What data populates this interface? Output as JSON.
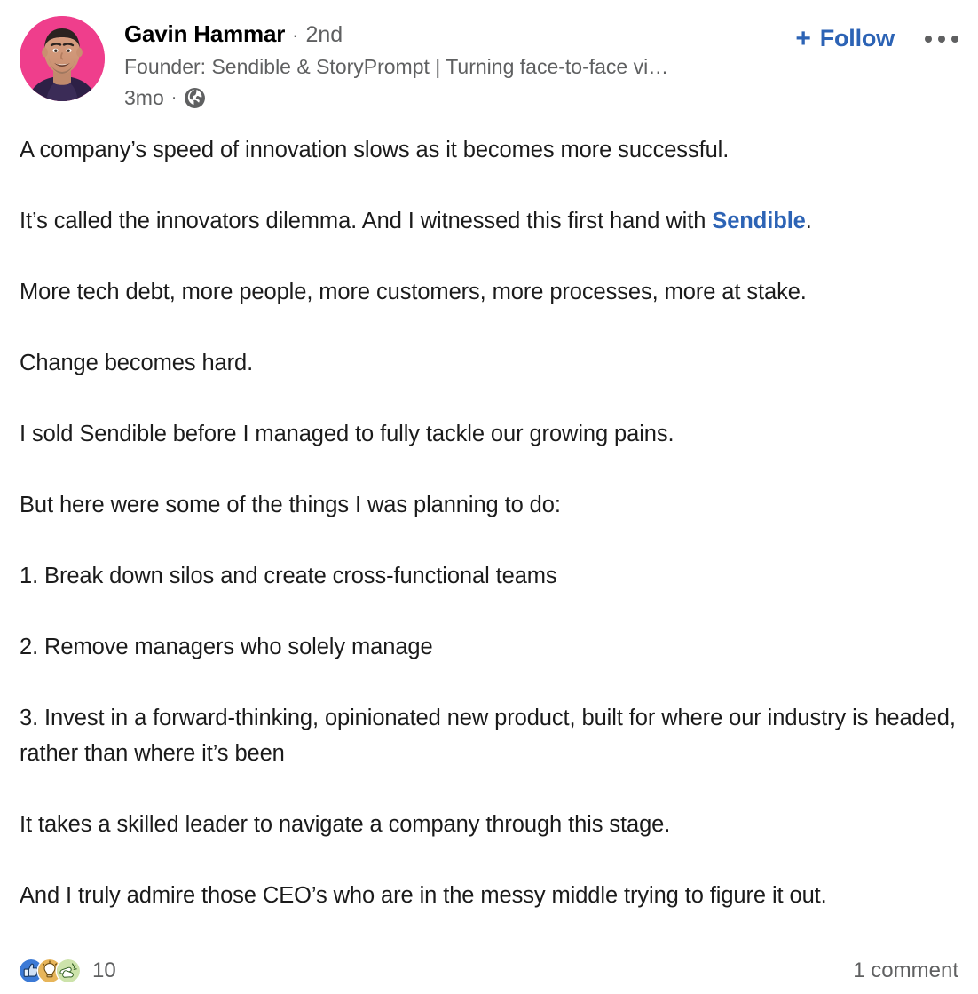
{
  "post": {
    "author": {
      "name": "Gavin Hammar",
      "separator": "·",
      "degree": "2nd",
      "headline": "Founder: Sendible & StoryPrompt | Turning face-to-face vi…",
      "avatar_background": "#ef3e8c",
      "avatar_alt": "avatar"
    },
    "meta": {
      "timestamp": "3mo",
      "separator": "·",
      "visibility_icon": "globe-icon"
    },
    "actions": {
      "follow_label": "Follow",
      "follow_plus": "+",
      "follow_color": "#2c63b5",
      "more_icon": "ellipsis-icon"
    },
    "content": {
      "paragraphs": [
        "A company’s speed of innovation slows as it becomes more successful.",
        "It’s called the innovators dilemma. And I witnessed this first hand with ",
        "More tech debt, more people, more customers, more processes, more at stake.",
        "Change becomes hard.",
        "I sold Sendible before I managed to fully tackle our growing pains.",
        "But here were some of the things I was planning to do:",
        "1. Break down silos and create cross-functional teams",
        "2. Remove managers who solely manage",
        "3. Invest in a forward-thinking, opinionated new product, built for where our industry is headed, rather than where it’s been",
        "It takes a skilled leader to navigate a company through this stage.",
        "And I truly admire those CEO’s who are in the messy middle trying to figure it out."
      ],
      "link": {
        "label": "Sendible",
        "trailing": ".",
        "color": "#2c63b5"
      }
    },
    "footer": {
      "reaction_count": "10",
      "comment_count": "1 comment",
      "reactions": [
        {
          "name": "like-reaction-icon",
          "color": "#3c7ad6"
        },
        {
          "name": "insightful-reaction-icon",
          "color": "#e7b55a"
        },
        {
          "name": "celebrate-reaction-icon",
          "color": "#c6dfa7"
        }
      ]
    }
  }
}
